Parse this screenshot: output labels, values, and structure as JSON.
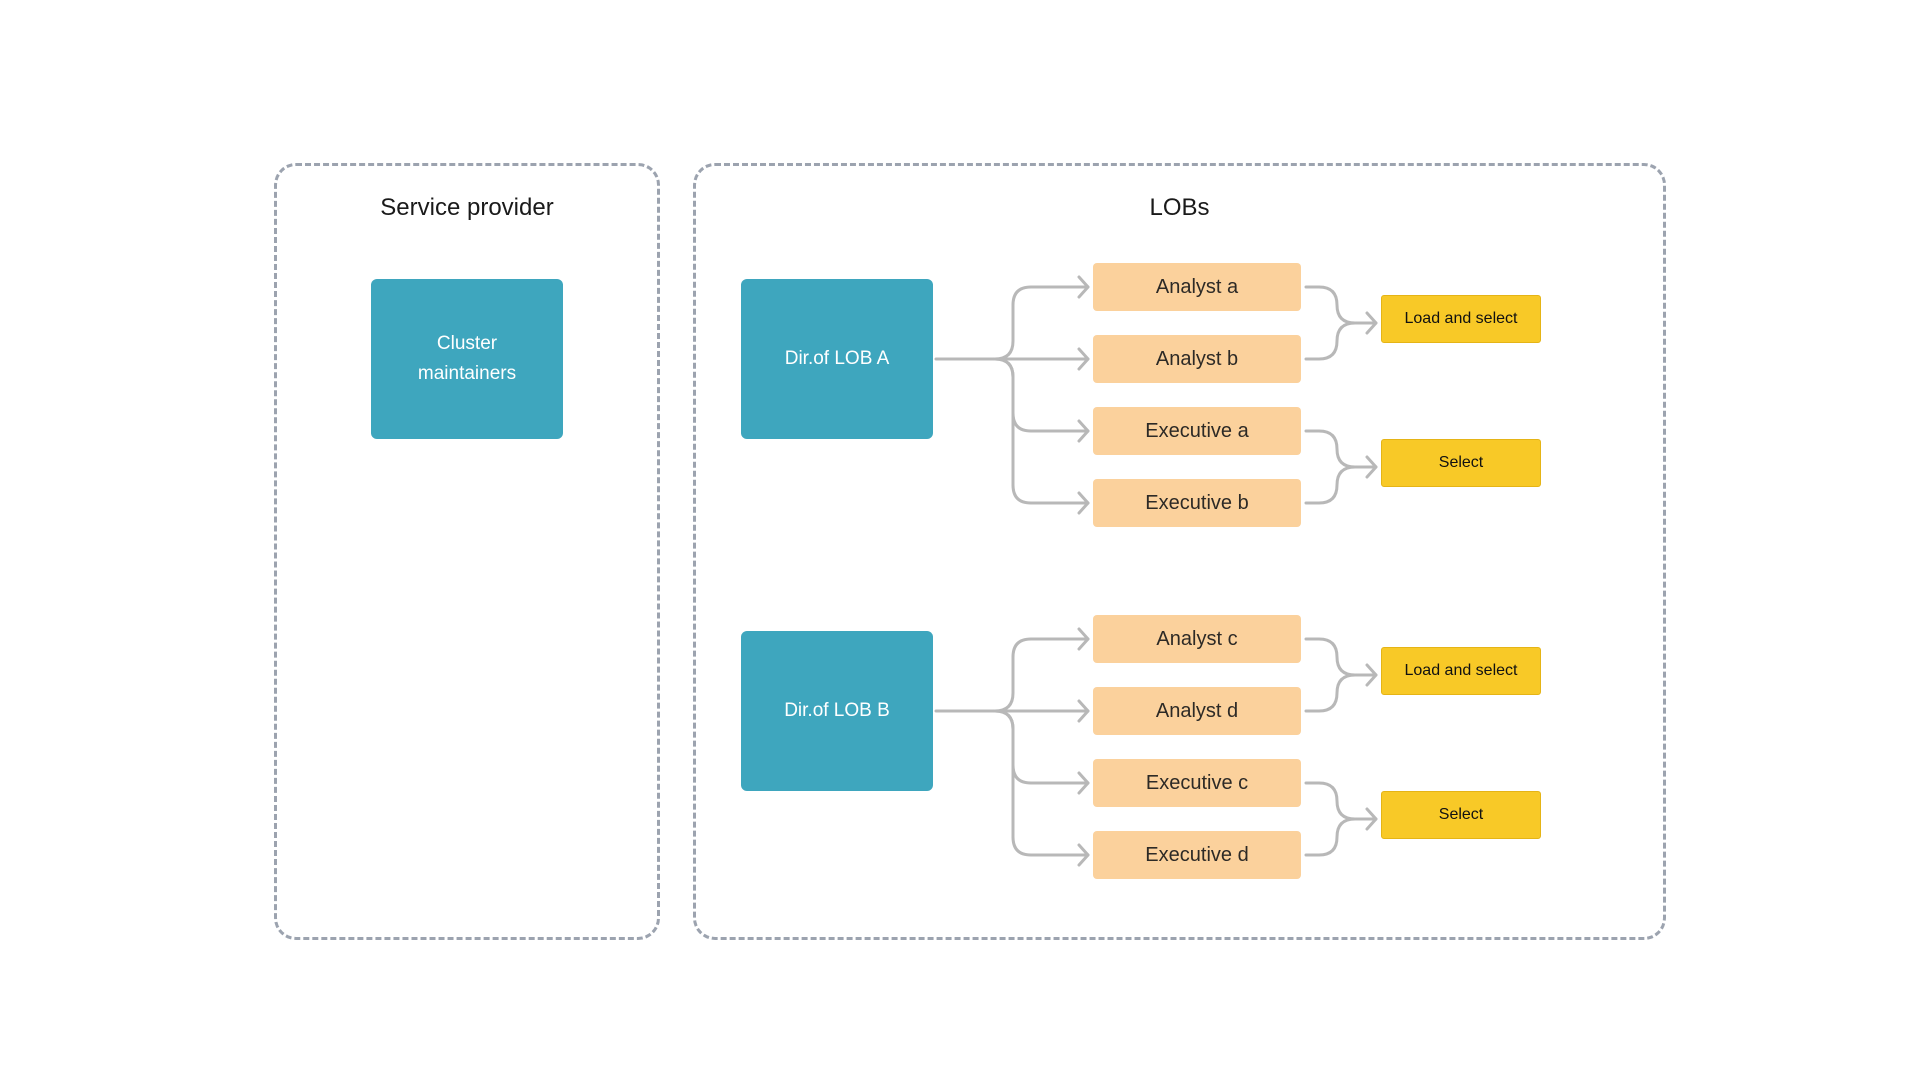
{
  "groups": {
    "service_provider": {
      "title": "Service provider",
      "node": "Cluster maintainers"
    },
    "lobs": {
      "title": "LOBs",
      "lob_a": {
        "director": "Dir.of LOB A",
        "roles": [
          "Analyst a",
          "Analyst b",
          "Executive a",
          "Executive b"
        ],
        "actions": [
          "Load and select",
          "Select"
        ]
      },
      "lob_b": {
        "director": "Dir.of LOB B",
        "roles": [
          "Analyst c",
          "Analyst d",
          "Executive c",
          "Executive d"
        ],
        "actions": [
          "Load and select",
          "Select"
        ]
      }
    }
  },
  "colors": {
    "director": "#3ea6be",
    "role": "#fbd19c",
    "action": "#f8c927",
    "connector": "#b8b8b8",
    "group_border": "#9ca3af"
  }
}
